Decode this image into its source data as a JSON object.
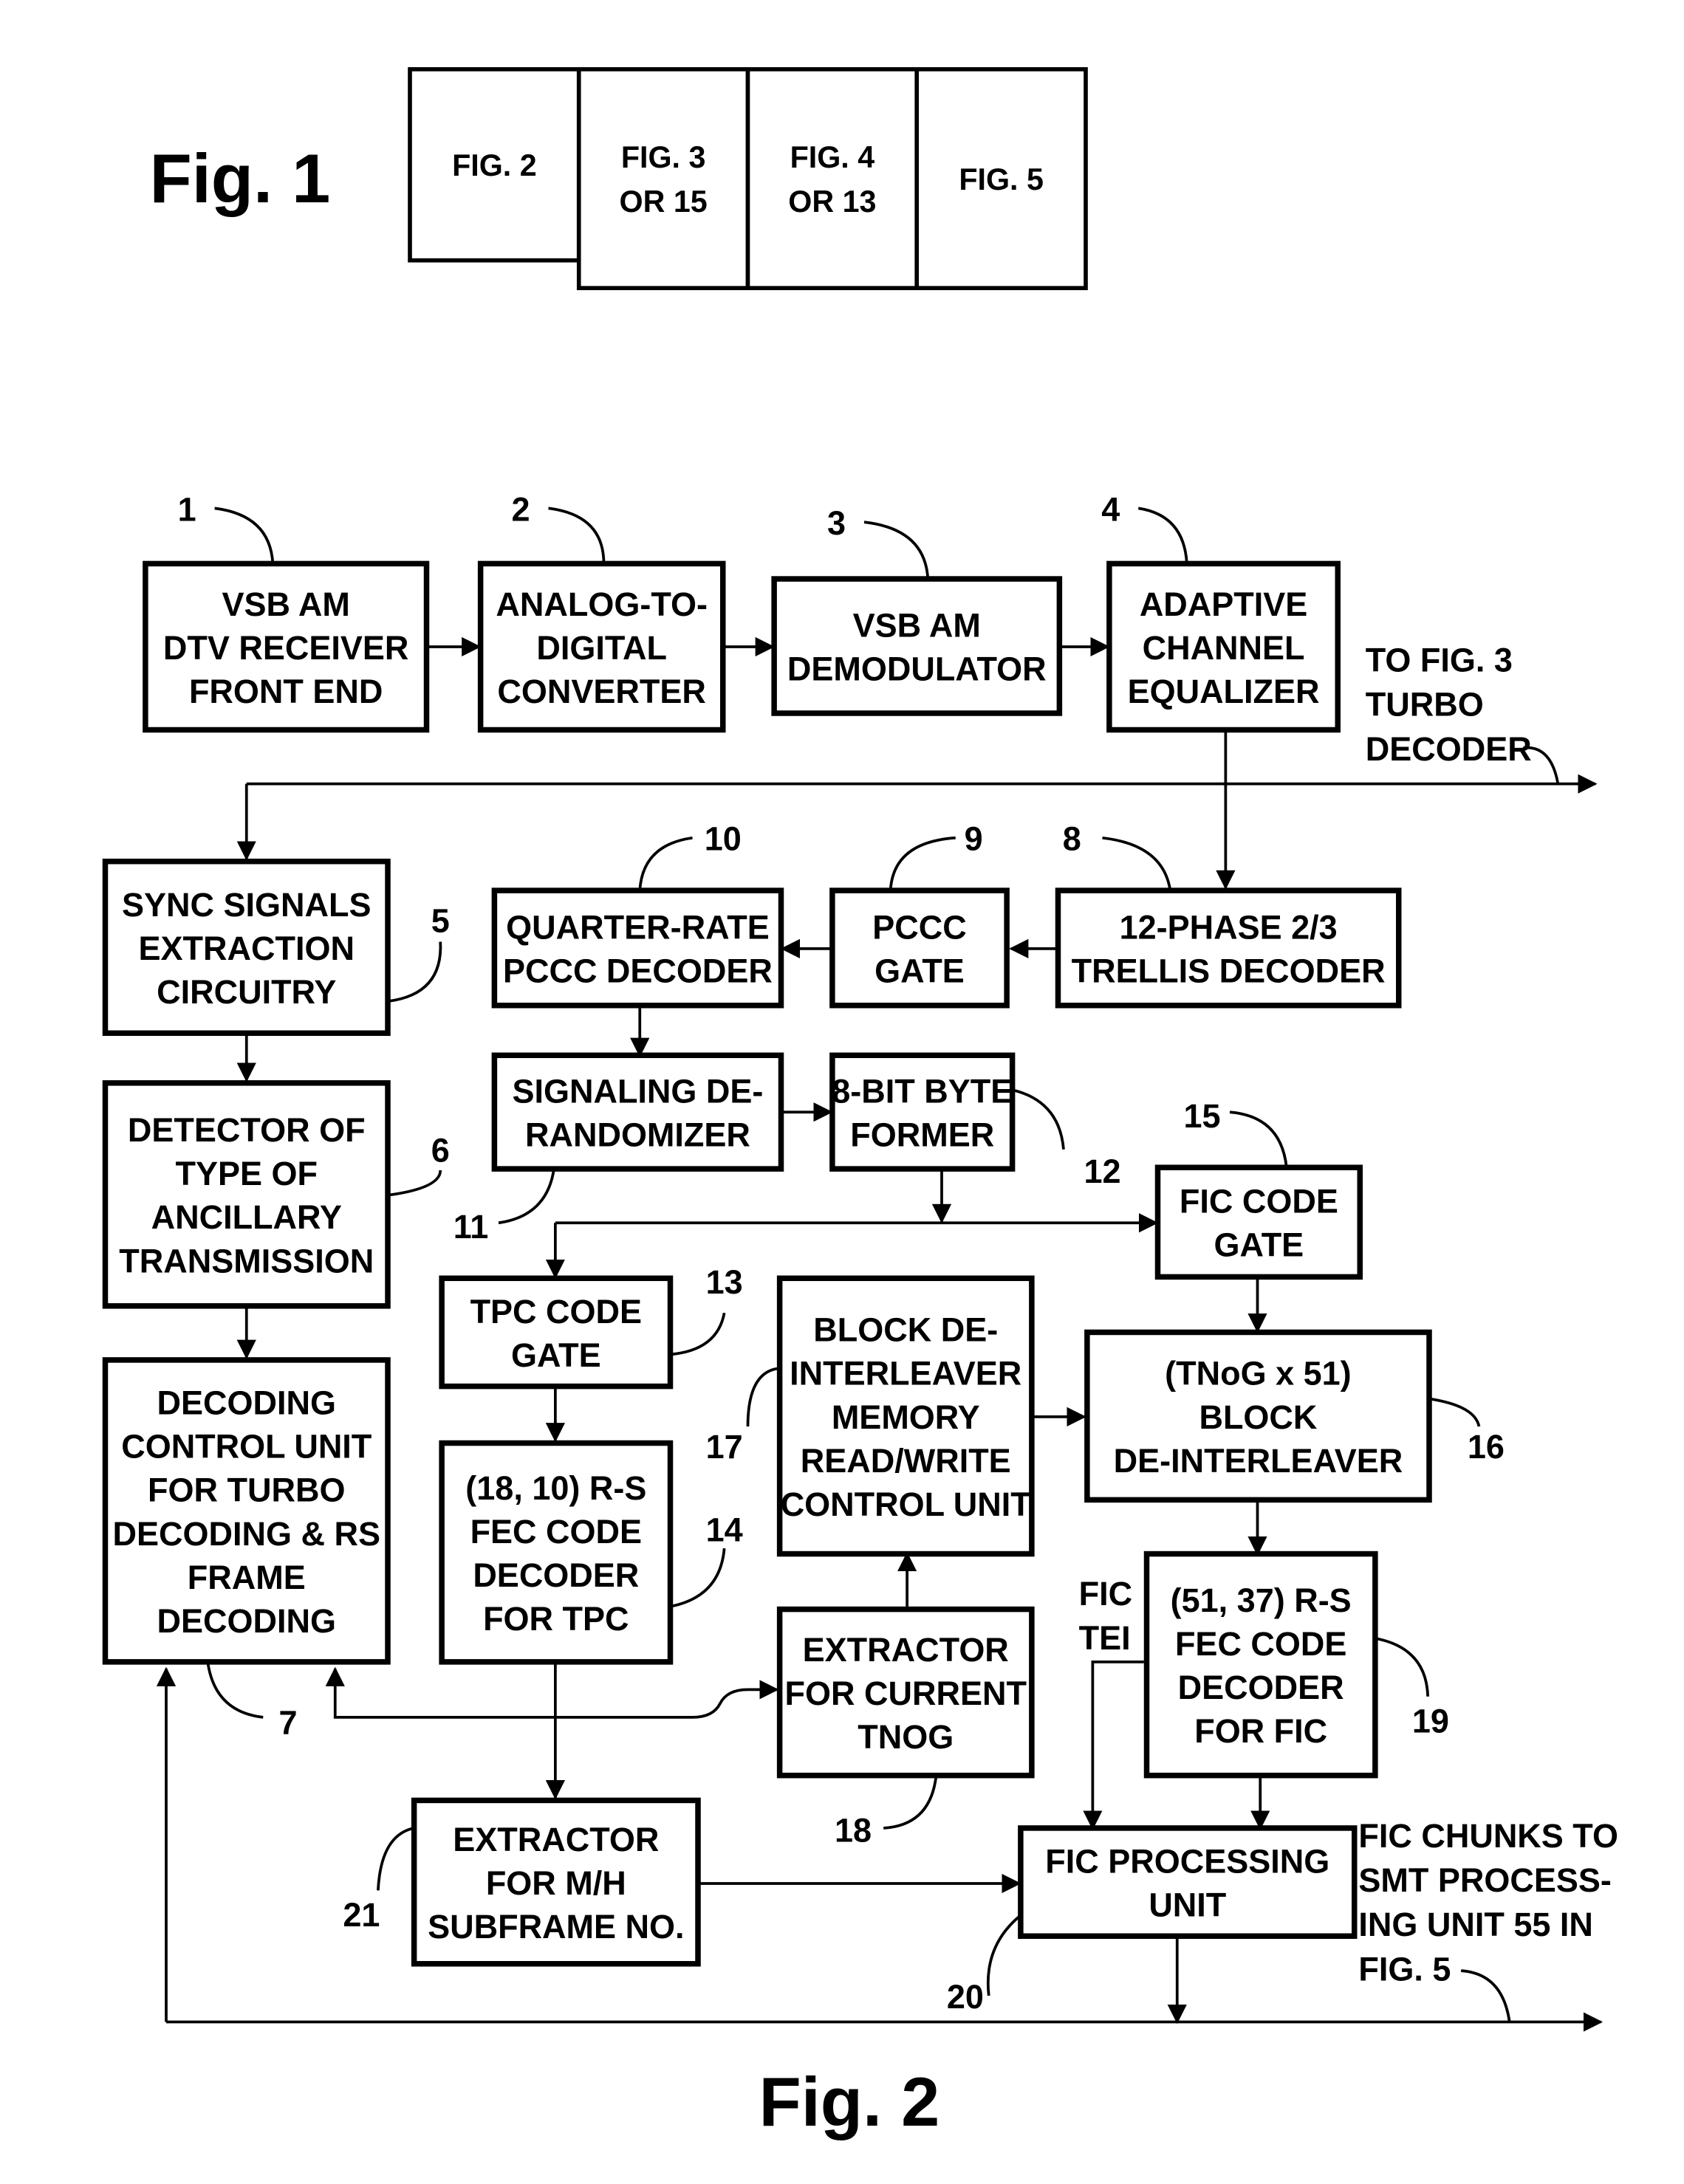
{
  "fig1": {
    "title": "Fig. 1",
    "panels": [
      {
        "lines": [
          "FIG. 2"
        ]
      },
      {
        "lines": [
          "FIG. 3",
          "OR 15"
        ]
      },
      {
        "lines": [
          "FIG. 4",
          "OR 13"
        ]
      },
      {
        "lines": [
          "FIG. 5"
        ]
      }
    ]
  },
  "fig2": {
    "title": "Fig. 2",
    "blocks": {
      "b1": {
        "ref": "1",
        "lines": [
          "VSB AM",
          "DTV RECEIVER",
          "FRONT  END"
        ]
      },
      "b2": {
        "ref": "2",
        "lines": [
          "ANALOG-TO-",
          "DIGITAL",
          "CONVERTER"
        ]
      },
      "b3": {
        "ref": "3",
        "lines": [
          "VSB AM",
          "DEMODULATOR"
        ]
      },
      "b4": {
        "ref": "4",
        "lines": [
          "ADAPTIVE",
          "CHANNEL",
          "EQUALIZER"
        ]
      },
      "b5": {
        "ref": "5",
        "lines": [
          "SYNC SIGNALS",
          "EXTRACTION",
          "CIRCUITRY"
        ]
      },
      "b6": {
        "ref": "6",
        "lines": [
          "DETECTOR OF",
          "TYPE OF",
          "ANCILLARY",
          "TRANSMISSION"
        ]
      },
      "b7": {
        "ref": "7",
        "lines": [
          "DECODING",
          "CONTROL UNIT",
          "FOR TURBO",
          "DECODING & RS",
          "FRAME",
          "DECODING"
        ]
      },
      "b8": {
        "ref": "8",
        "lines": [
          "12-PHASE 2/3",
          "TRELLIS DECODER"
        ]
      },
      "b9": {
        "ref": "9",
        "lines": [
          "PCCC",
          "GATE"
        ]
      },
      "b10": {
        "ref": "10",
        "lines": [
          "QUARTER-RATE",
          "PCCC DECODER"
        ]
      },
      "b11": {
        "ref": "11",
        "lines": [
          "SIGNALING DE-",
          "RANDOMIZER"
        ]
      },
      "b12": {
        "ref": "12",
        "lines": [
          "8-BIT BYTE",
          "FORMER"
        ]
      },
      "b13": {
        "ref": "13",
        "lines": [
          "TPC CODE",
          "GATE"
        ]
      },
      "b14": {
        "ref": "14",
        "lines": [
          "(18, 10) R-S",
          "FEC CODE",
          "DECODER",
          "FOR TPC"
        ]
      },
      "b15": {
        "ref": "15",
        "lines": [
          "FIC CODE",
          "GATE"
        ]
      },
      "b16": {
        "ref": "16",
        "lines": [
          "(TNoG x 51)",
          "BLOCK",
          "DE-INTERLEAVER"
        ]
      },
      "b17": {
        "ref": "17",
        "lines": [
          "BLOCK DE-",
          "INTERLEAVER",
          "MEMORY",
          "READ/WRITE",
          "CONTROL UNIT"
        ]
      },
      "b18": {
        "ref": "18",
        "lines": [
          "EXTRACTOR",
          "FOR CURRENT",
          "TNOG"
        ]
      },
      "b19": {
        "ref": "19",
        "lines": [
          "(51, 37) R-S",
          "FEC CODE",
          "DECODER",
          "FOR FIC"
        ]
      },
      "b20": {
        "ref": "20",
        "lines": [
          "FIC PROCESSING",
          "UNIT"
        ]
      },
      "b21": {
        "ref": "21",
        "lines": [
          "EXTRACTOR",
          "FOR M/H",
          "SUBFRAME NO."
        ]
      }
    },
    "annotations": {
      "to_fig3": [
        "TO FIG. 3",
        "TURBO",
        "DECODER"
      ],
      "fic_tei": [
        "FIC",
        "TEI"
      ],
      "fic_chunks": [
        "FIC CHUNKS TO",
        "SMT PROCESS-",
        "ING UNIT 55 IN",
        "FIG. 5"
      ]
    }
  }
}
